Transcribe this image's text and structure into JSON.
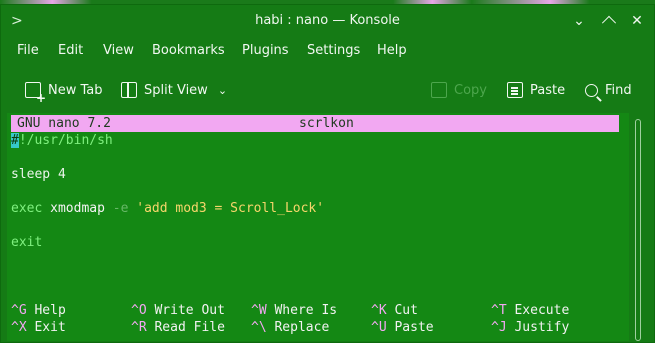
{
  "window": {
    "title": "habi : nano — Konsole",
    "app_icon": "terminal-icon",
    "controls": [
      "chevron-down-icon",
      "restore-icon",
      "close-icon"
    ]
  },
  "menubar": {
    "items": [
      "File",
      "Edit",
      "View",
      "Bookmarks",
      "Plugins",
      "Settings",
      "Help"
    ]
  },
  "toolbar": {
    "new_tab": "New Tab",
    "split_view": "Split View",
    "copy": "Copy",
    "paste": "Paste",
    "find": "Find"
  },
  "nano": {
    "version": "GNU nano 7.2",
    "filename": "scrlkon",
    "lines": {
      "shebang_cursor": "#",
      "shebang_rest": "!/usr/bin/sh",
      "sleep": "sleep 4",
      "exec_kw": "exec",
      "exec_cmd": "xmodmap",
      "exec_op": "-e",
      "exec_str": "'add mod3 = Scroll_Lock'",
      "exit": "exit"
    },
    "shortcuts_row1": [
      {
        "key": "^G",
        "label": "Help"
      },
      {
        "key": "^O",
        "label": "Write Out"
      },
      {
        "key": "^W",
        "label": "Where Is"
      },
      {
        "key": "^K",
        "label": "Cut"
      },
      {
        "key": "^T",
        "label": "Execute"
      }
    ],
    "shortcuts_row2": [
      {
        "key": "^X",
        "label": "Exit"
      },
      {
        "key": "^R",
        "label": "Read File"
      },
      {
        "key": "^\\",
        "label": "Replace"
      },
      {
        "key": "^U",
        "label": "Paste"
      },
      {
        "key": "^J",
        "label": "Justify"
      }
    ]
  },
  "colors": {
    "window_bg": "#157b15",
    "header_bg": "#f2a8f2",
    "string": "#f7d66b",
    "keyword": "#7ff07f"
  }
}
